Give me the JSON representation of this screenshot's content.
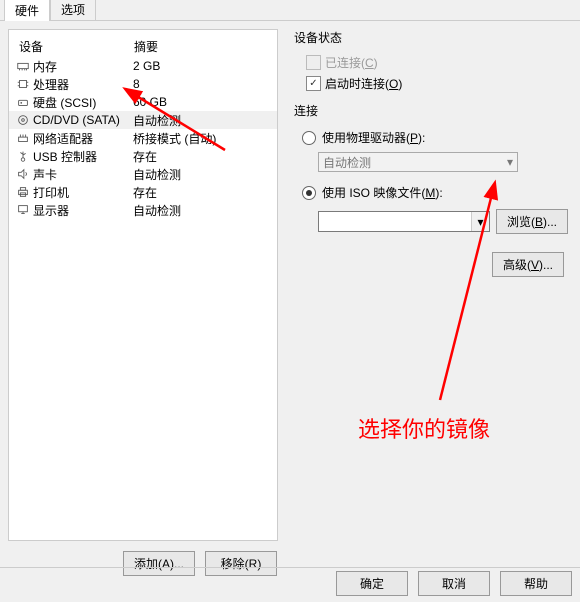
{
  "tabs": {
    "hardware": "硬件",
    "options": "选项"
  },
  "deviceList": {
    "headers": {
      "device": "设备",
      "summary": "摘要"
    },
    "rows": [
      {
        "name": "内存",
        "value": "2 GB",
        "icon": "memory"
      },
      {
        "name": "处理器",
        "value": "8",
        "icon": "cpu"
      },
      {
        "name": "硬盘 (SCSI)",
        "value": "60 GB",
        "icon": "disk"
      },
      {
        "name": "CD/DVD (SATA)",
        "value": "自动检测",
        "icon": "cd",
        "selected": true
      },
      {
        "name": "网络适配器",
        "value": "桥接模式 (自动)",
        "icon": "net"
      },
      {
        "name": "USB 控制器",
        "value": "存在",
        "icon": "usb"
      },
      {
        "name": "声卡",
        "value": "自动检测",
        "icon": "sound"
      },
      {
        "name": "打印机",
        "value": "存在",
        "icon": "printer"
      },
      {
        "name": "显示器",
        "value": "自动检测",
        "icon": "display"
      }
    ]
  },
  "deviceStatus": {
    "title": "设备状态",
    "connected": "已连接(C)",
    "connectAtPower": "启动时连接(O)"
  },
  "connection": {
    "title": "连接",
    "physicalDrive": "使用物理驱动器(P):",
    "autoDetect": "自动检测",
    "useIso": "使用 ISO 映像文件(M):",
    "browse": "浏览(B)..."
  },
  "buttons": {
    "advanced": "高级(V)...",
    "add": "添加(A)...",
    "remove": "移除(R)",
    "ok": "确定",
    "cancel": "取消",
    "help": "帮助"
  },
  "annotation": "选择你的镜像"
}
